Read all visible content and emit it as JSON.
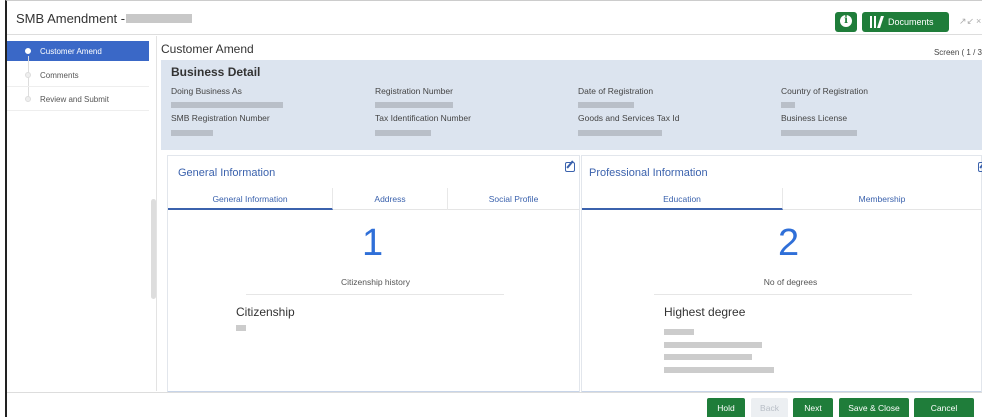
{
  "window": {
    "title": "SMB Amendment - ",
    "documents_label": "Documents",
    "info_glyph": "i",
    "restore_glyph": "↗↙",
    "close_glyph": "×"
  },
  "sidebar": {
    "items": [
      {
        "label": "Customer Amend",
        "active": true
      },
      {
        "label": "Comments",
        "active": false
      },
      {
        "label": "Review and Submit",
        "active": false
      }
    ]
  },
  "main": {
    "title": "Customer Amend",
    "screen_indicator": "Screen ( 1 / 3"
  },
  "business_detail": {
    "title": "Business Detail",
    "fields": [
      {
        "label": "Doing Business As"
      },
      {
        "label": "Registration Number"
      },
      {
        "label": "Date of Registration"
      },
      {
        "label": "Country of Registration"
      },
      {
        "label": "SMB Registration Number"
      },
      {
        "label": "Tax Identification Number"
      },
      {
        "label": "Goods and Services Tax Id"
      },
      {
        "label": "Business License"
      }
    ]
  },
  "general_info": {
    "title": "General Information",
    "tabs": [
      "General Information",
      "Address",
      "Social Profile"
    ],
    "count": "1",
    "count_label": "Citizenship history",
    "section_title": "Citizenship"
  },
  "professional_info": {
    "title": "Professional Information",
    "tabs": [
      "Education",
      "Membership"
    ],
    "count": "2",
    "count_label": "No of degrees",
    "section_title": "Highest degree"
  },
  "footer": {
    "hold": "Hold",
    "back": "Back",
    "next": "Next",
    "save_close": "Save & Close",
    "cancel": "Cancel"
  },
  "colors": {
    "accent_green": "#1f7d3a",
    "active_blue": "#3a68c7",
    "link_blue": "#3b62ad",
    "number_blue": "#2f6fd8",
    "panel_bg": "#dce4ef"
  },
  "icons": {
    "info": "info-icon",
    "documents": "library-icon",
    "edit": "edit-icon"
  }
}
